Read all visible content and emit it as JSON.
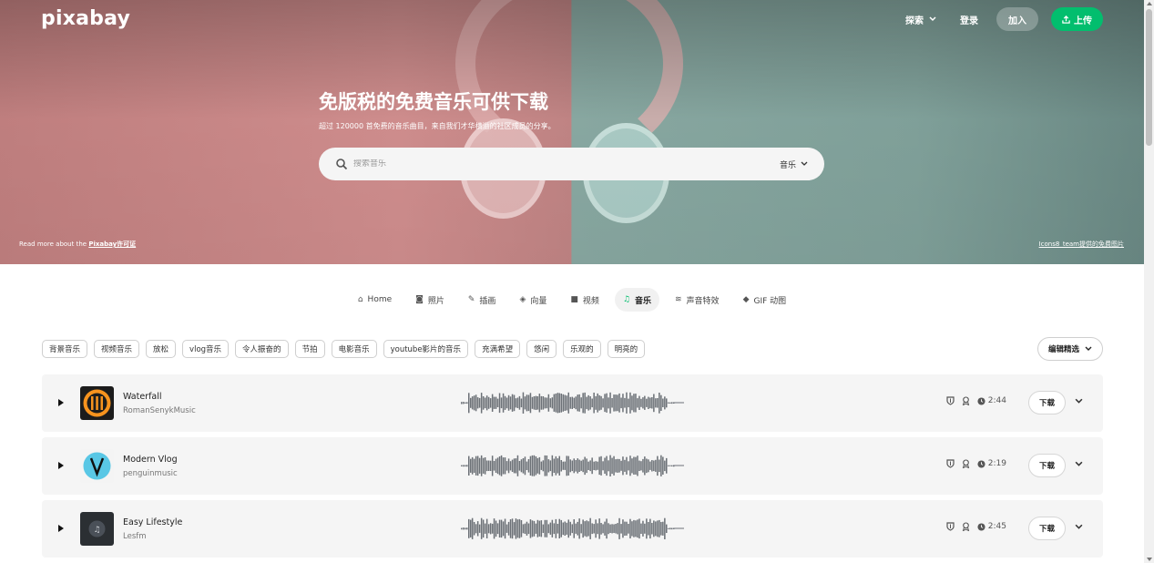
{
  "header": {
    "logo": "pixabay",
    "nav": {
      "explore": "探索",
      "login": "登录",
      "join": "加入",
      "upload": "上传"
    }
  },
  "hero": {
    "title": "免版税的免费音乐可供下载",
    "subtitle": "超过 120000 首免费的音乐曲目，来自我们才华横溢的社区成员的分享。",
    "search_placeholder": "搜索音乐",
    "search_type": "音乐",
    "license_prefix": "Read more about the ",
    "license_link": "Pixabay许可证",
    "credit": "Icons8_team提供的免费图片"
  },
  "category_tabs": [
    {
      "label": "Home",
      "icon": "home-icon",
      "glyph": "⌂",
      "active": false
    },
    {
      "label": "照片",
      "icon": "camera-icon",
      "glyph": "◙",
      "active": false
    },
    {
      "label": "插画",
      "icon": "brush-icon",
      "glyph": "✎",
      "active": false
    },
    {
      "label": "向量",
      "icon": "vector-icon",
      "glyph": "◈",
      "active": false
    },
    {
      "label": "视频",
      "icon": "video-icon",
      "glyph": "■",
      "active": false
    },
    {
      "label": "音乐",
      "icon": "music-note-icon",
      "glyph": "♫",
      "active": true
    },
    {
      "label": "声音特效",
      "icon": "soundwave-icon",
      "glyph": "≋",
      "active": false
    },
    {
      "label": "GIF 动图",
      "icon": "gif-icon",
      "glyph": "◆",
      "active": false
    }
  ],
  "tags": [
    "背景音乐",
    "视频音乐",
    "放松",
    "vlog音乐",
    "令人振奋的",
    "节拍",
    "电影音乐",
    "youtube影片的音乐",
    "充满希望",
    "悠闲",
    "乐观的",
    "明亮的"
  ],
  "edit_picks": "编辑精选",
  "tracks": [
    {
      "title": "Waterfall",
      "artist": "RomanSenykMusic",
      "duration": "2:44",
      "download": "下载",
      "cover_color": "#f7931e"
    },
    {
      "title": "Modern Vlog",
      "artist": "penguinmusic",
      "duration": "2:19",
      "download": "下载",
      "cover_color": "#59c7e5"
    },
    {
      "title": "Easy Lifestyle",
      "artist": "Lesfm",
      "duration": "2:45",
      "download": "下载",
      "cover_color": "#2b2f33"
    }
  ],
  "colors": {
    "accent": "#02be6e",
    "wave": "#6b7076"
  }
}
